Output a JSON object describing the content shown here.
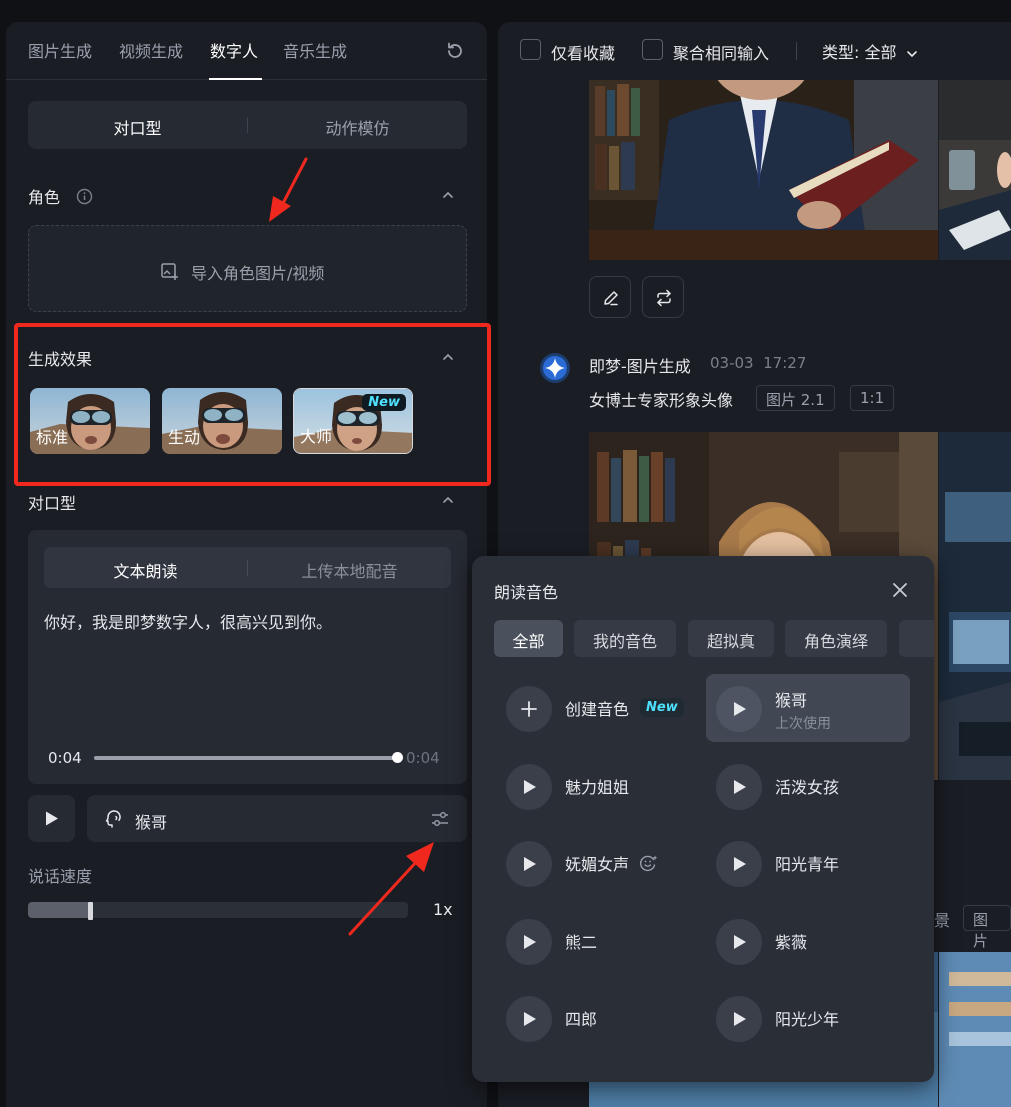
{
  "left": {
    "tabs": [
      "图片生成",
      "视频生成",
      "数字人",
      "音乐生成"
    ],
    "active_tab": "数字人",
    "mode_segment": [
      "对口型",
      "动作模仿"
    ],
    "role_section": {
      "title": "角色",
      "upload_label": "导入角色图片/视频"
    },
    "effect_section": {
      "title": "生成效果",
      "options": [
        {
          "label": "标准",
          "badge": ""
        },
        {
          "label": "生动",
          "badge": ""
        },
        {
          "label": "大师",
          "badge": "New"
        }
      ],
      "selected": "大师"
    },
    "lipsync_section": {
      "title": "对口型",
      "tabs": [
        "文本朗读",
        "上传本地配音"
      ],
      "text": "你好，我是即梦数字人，很高兴见到你。",
      "time_current": "0:04",
      "time_total": "0:04",
      "progress": 1.0
    },
    "voice": {
      "name": "猴哥"
    },
    "speed": {
      "label": "说话速度",
      "value": "1x",
      "level": 0.16
    }
  },
  "right": {
    "filters": {
      "only_favorites": "仅看收藏",
      "merge_same": "聚合相同输入",
      "type_label": "类型: 全部"
    },
    "generation": {
      "title": "即梦-图片生成",
      "date": "03-03",
      "time": "17:27",
      "prompt": "女博士专家形象头像",
      "tags": [
        "图片 2.1",
        "1:1"
      ]
    },
    "partial_text": {
      "left": "景",
      "tag": "图片"
    }
  },
  "voice_popup": {
    "title": "朗读音色",
    "categories": [
      "全部",
      "我的音色",
      "超拟真",
      "角色演绎"
    ],
    "active_category": "全部",
    "create_label": "创建音色",
    "create_badge": "New",
    "voices": [
      {
        "name": "猴哥",
        "sub": "上次使用"
      },
      {
        "name": "魅力姐姐",
        "sub": ""
      },
      {
        "name": "活泼女孩",
        "sub": ""
      },
      {
        "name": "妩媚女声",
        "sub": ""
      },
      {
        "name": "阳光青年",
        "sub": ""
      },
      {
        "name": "熊二",
        "sub": ""
      },
      {
        "name": "紫薇",
        "sub": ""
      },
      {
        "name": "四郎",
        "sub": ""
      },
      {
        "name": "阳光少年",
        "sub": ""
      }
    ]
  },
  "colors": {
    "annotation_red": "#f0281e",
    "new_badge": "#4fe0ff",
    "panel_bg": "#1a1d24"
  }
}
